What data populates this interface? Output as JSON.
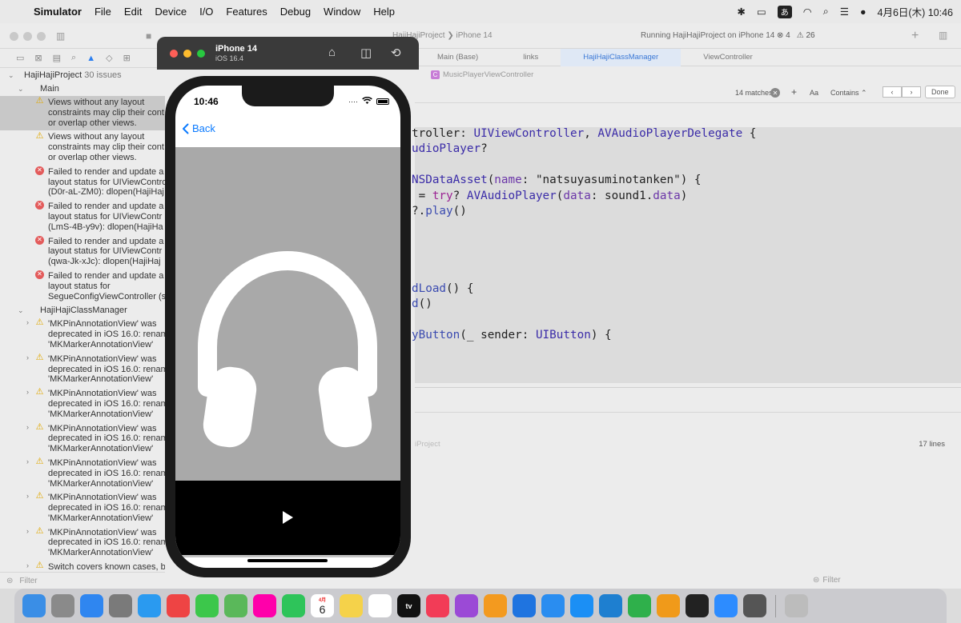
{
  "menubar": {
    "app": "Simulator",
    "items": [
      "File",
      "Edit",
      "Device",
      "I/O",
      "Features",
      "Debug",
      "Window",
      "Help"
    ],
    "ime": "あ",
    "datetime": "4月6日(木) 10:46"
  },
  "xcode": {
    "project_title": "HajiHajiProject",
    "scheme": "HajiHajiProject ❯ iPhone 14",
    "status": "Running HajiHajiProject on iPhone 14",
    "error_count": "4",
    "warning_count": "26",
    "tabs": [
      "Main (Base)",
      "links",
      "HajiHajiClassManager",
      "ViewController"
    ],
    "breadcrumb": "MusicPlayerViewController",
    "find": {
      "matches": "14 matches",
      "aa": "Aa",
      "mode": "Contains",
      "done": "Done"
    },
    "code_lines": [
      {
        "row": 0,
        "parts": [
          [
            "troller: ",
            ""
          ],
          [
            "UIViewController",
            "ty"
          ],
          [
            ", ",
            ""
          ],
          [
            "AVAudioPlayerDelegate",
            "ty"
          ],
          [
            " {",
            ""
          ]
        ]
      },
      {
        "row": 1,
        "parts": [
          [
            "udioPlayer",
            "ty"
          ],
          [
            "?",
            ""
          ]
        ]
      },
      {
        "row": 3,
        "parts": [
          [
            "NSDataAsset",
            "ty"
          ],
          [
            "(",
            ""
          ],
          [
            "name",
            "pr"
          ],
          [
            ": \"natsuyasuminotanken\") {",
            ""
          ]
        ]
      },
      {
        "row": 4,
        "parts": [
          [
            " = ",
            ""
          ],
          [
            "try",
            "kw"
          ],
          [
            "? ",
            ""
          ],
          [
            "AVAudioPlayer",
            "ty"
          ],
          [
            "(",
            ""
          ],
          [
            "data",
            "pr"
          ],
          [
            ": sound1.",
            ""
          ],
          [
            "data",
            "pr"
          ],
          [
            ")",
            ""
          ]
        ]
      },
      {
        "row": 5,
        "parts": [
          [
            "?.",
            ""
          ],
          [
            "play",
            "fn"
          ],
          [
            "()",
            ""
          ]
        ]
      },
      {
        "row": 10,
        "parts": [
          [
            "dLoad",
            "fn"
          ],
          [
            "() {",
            ""
          ]
        ]
      },
      {
        "row": 11,
        "parts": [
          [
            "d",
            "fn"
          ],
          [
            "()",
            ""
          ]
        ]
      },
      {
        "row": 13,
        "parts": [
          [
            "yButton",
            "fn"
          ],
          [
            "(_ sender: ",
            ""
          ],
          [
            "UIButton",
            "ty"
          ],
          [
            ") {",
            ""
          ]
        ]
      }
    ],
    "debug_project": "iProject",
    "line_count": "17 lines",
    "filter_placeholder": "Filter"
  },
  "navigator": {
    "project": "HajiHajiProject",
    "issue_count": "30 issues",
    "groups": [
      {
        "name": "Main",
        "items": [
          {
            "kind": "warn",
            "text": [
              "Views without any layout",
              "constraints may clip their cont",
              "or overlap other views."
            ],
            "selected": true
          },
          {
            "kind": "warn",
            "text": [
              "Views without any layout",
              "constraints may clip their cont",
              "or overlap other views."
            ]
          },
          {
            "kind": "err",
            "text": [
              "Failed to render and update a",
              "layout status for UIViewContro",
              "(D0r-aL-ZM0): dlopen(HajiHaj"
            ]
          },
          {
            "kind": "err",
            "text": [
              "Failed to render and update a",
              "layout status for UIViewContr",
              "(LmS-4B-y9v): dlopen(HajiHa"
            ]
          },
          {
            "kind": "err",
            "text": [
              "Failed to render and update a",
              "layout status for UIViewContr",
              "(qwa-Jk-xJc): dlopen(HajiHaj"
            ]
          },
          {
            "kind": "err",
            "text": [
              "Failed to render and update a",
              "layout status for",
              "SegueConfigViewController (s"
            ]
          }
        ]
      },
      {
        "name": "HajiHajiClassManager",
        "items": [
          {
            "kind": "warn",
            "text": [
              "'MKPinAnnotationView' was",
              "deprecated in iOS 16.0: renam",
              "'MKMarkerAnnotationView'"
            ]
          },
          {
            "kind": "warn",
            "text": [
              "'MKPinAnnotationView' was",
              "deprecated in iOS 16.0: renam",
              "'MKMarkerAnnotationView'"
            ]
          },
          {
            "kind": "warn",
            "text": [
              "'MKPinAnnotationView' was",
              "deprecated in iOS 16.0: renam",
              "'MKMarkerAnnotationView'"
            ]
          },
          {
            "kind": "warn",
            "text": [
              "'MKPinAnnotationView' was",
              "deprecated in iOS 16.0: renam",
              "'MKMarkerAnnotationView'"
            ]
          },
          {
            "kind": "warn",
            "text": [
              "'MKPinAnnotationView' was",
              "deprecated in iOS 16.0: renam",
              "'MKMarkerAnnotationView'"
            ]
          },
          {
            "kind": "warn",
            "text": [
              "'MKPinAnnotationView' was",
              "deprecated in iOS 16.0: renam",
              "'MKMarkerAnnotationView'"
            ]
          },
          {
            "kind": "warn",
            "text": [
              "'MKPinAnnotationView' was",
              "deprecated in iOS 16.0: renam",
              "'MKMarkerAnnotationView'"
            ]
          },
          {
            "kind": "warn",
            "text": [
              "Switch covers known cases, bu"
            ]
          }
        ]
      }
    ]
  },
  "simulator": {
    "device": "iPhone 14",
    "os": "iOS 16.4",
    "time": "10:46",
    "back_label": "Back",
    "artwork_icon": "headphones-icon",
    "play_icon": "play-icon"
  },
  "dock": {
    "items": [
      "finder-icon",
      "launchpad-icon",
      "mail-icon",
      "system-settings-icon",
      "safari-icon",
      "chrome-icon",
      "messages-icon",
      "maps-icon",
      "photos-icon",
      "facetime-icon",
      "calendar-icon",
      "notes-icon",
      "reminders-icon",
      "tv-icon",
      "music-icon",
      "podcasts-icon",
      "books-icon",
      "xcode-icon",
      "simulator-icon",
      "app-store-icon",
      "vscode-icon",
      "numbers-icon",
      "pages-icon",
      "terminal-icon",
      "zoom-icon",
      "calculator-icon",
      "trash-icon"
    ],
    "calendar_month": "4月",
    "calendar_day": "6",
    "tv_label": "tv"
  },
  "colors": {
    "accent": "#0a7aff",
    "artwork_bg": "#a9a9a9",
    "player_bg": "#000000"
  }
}
